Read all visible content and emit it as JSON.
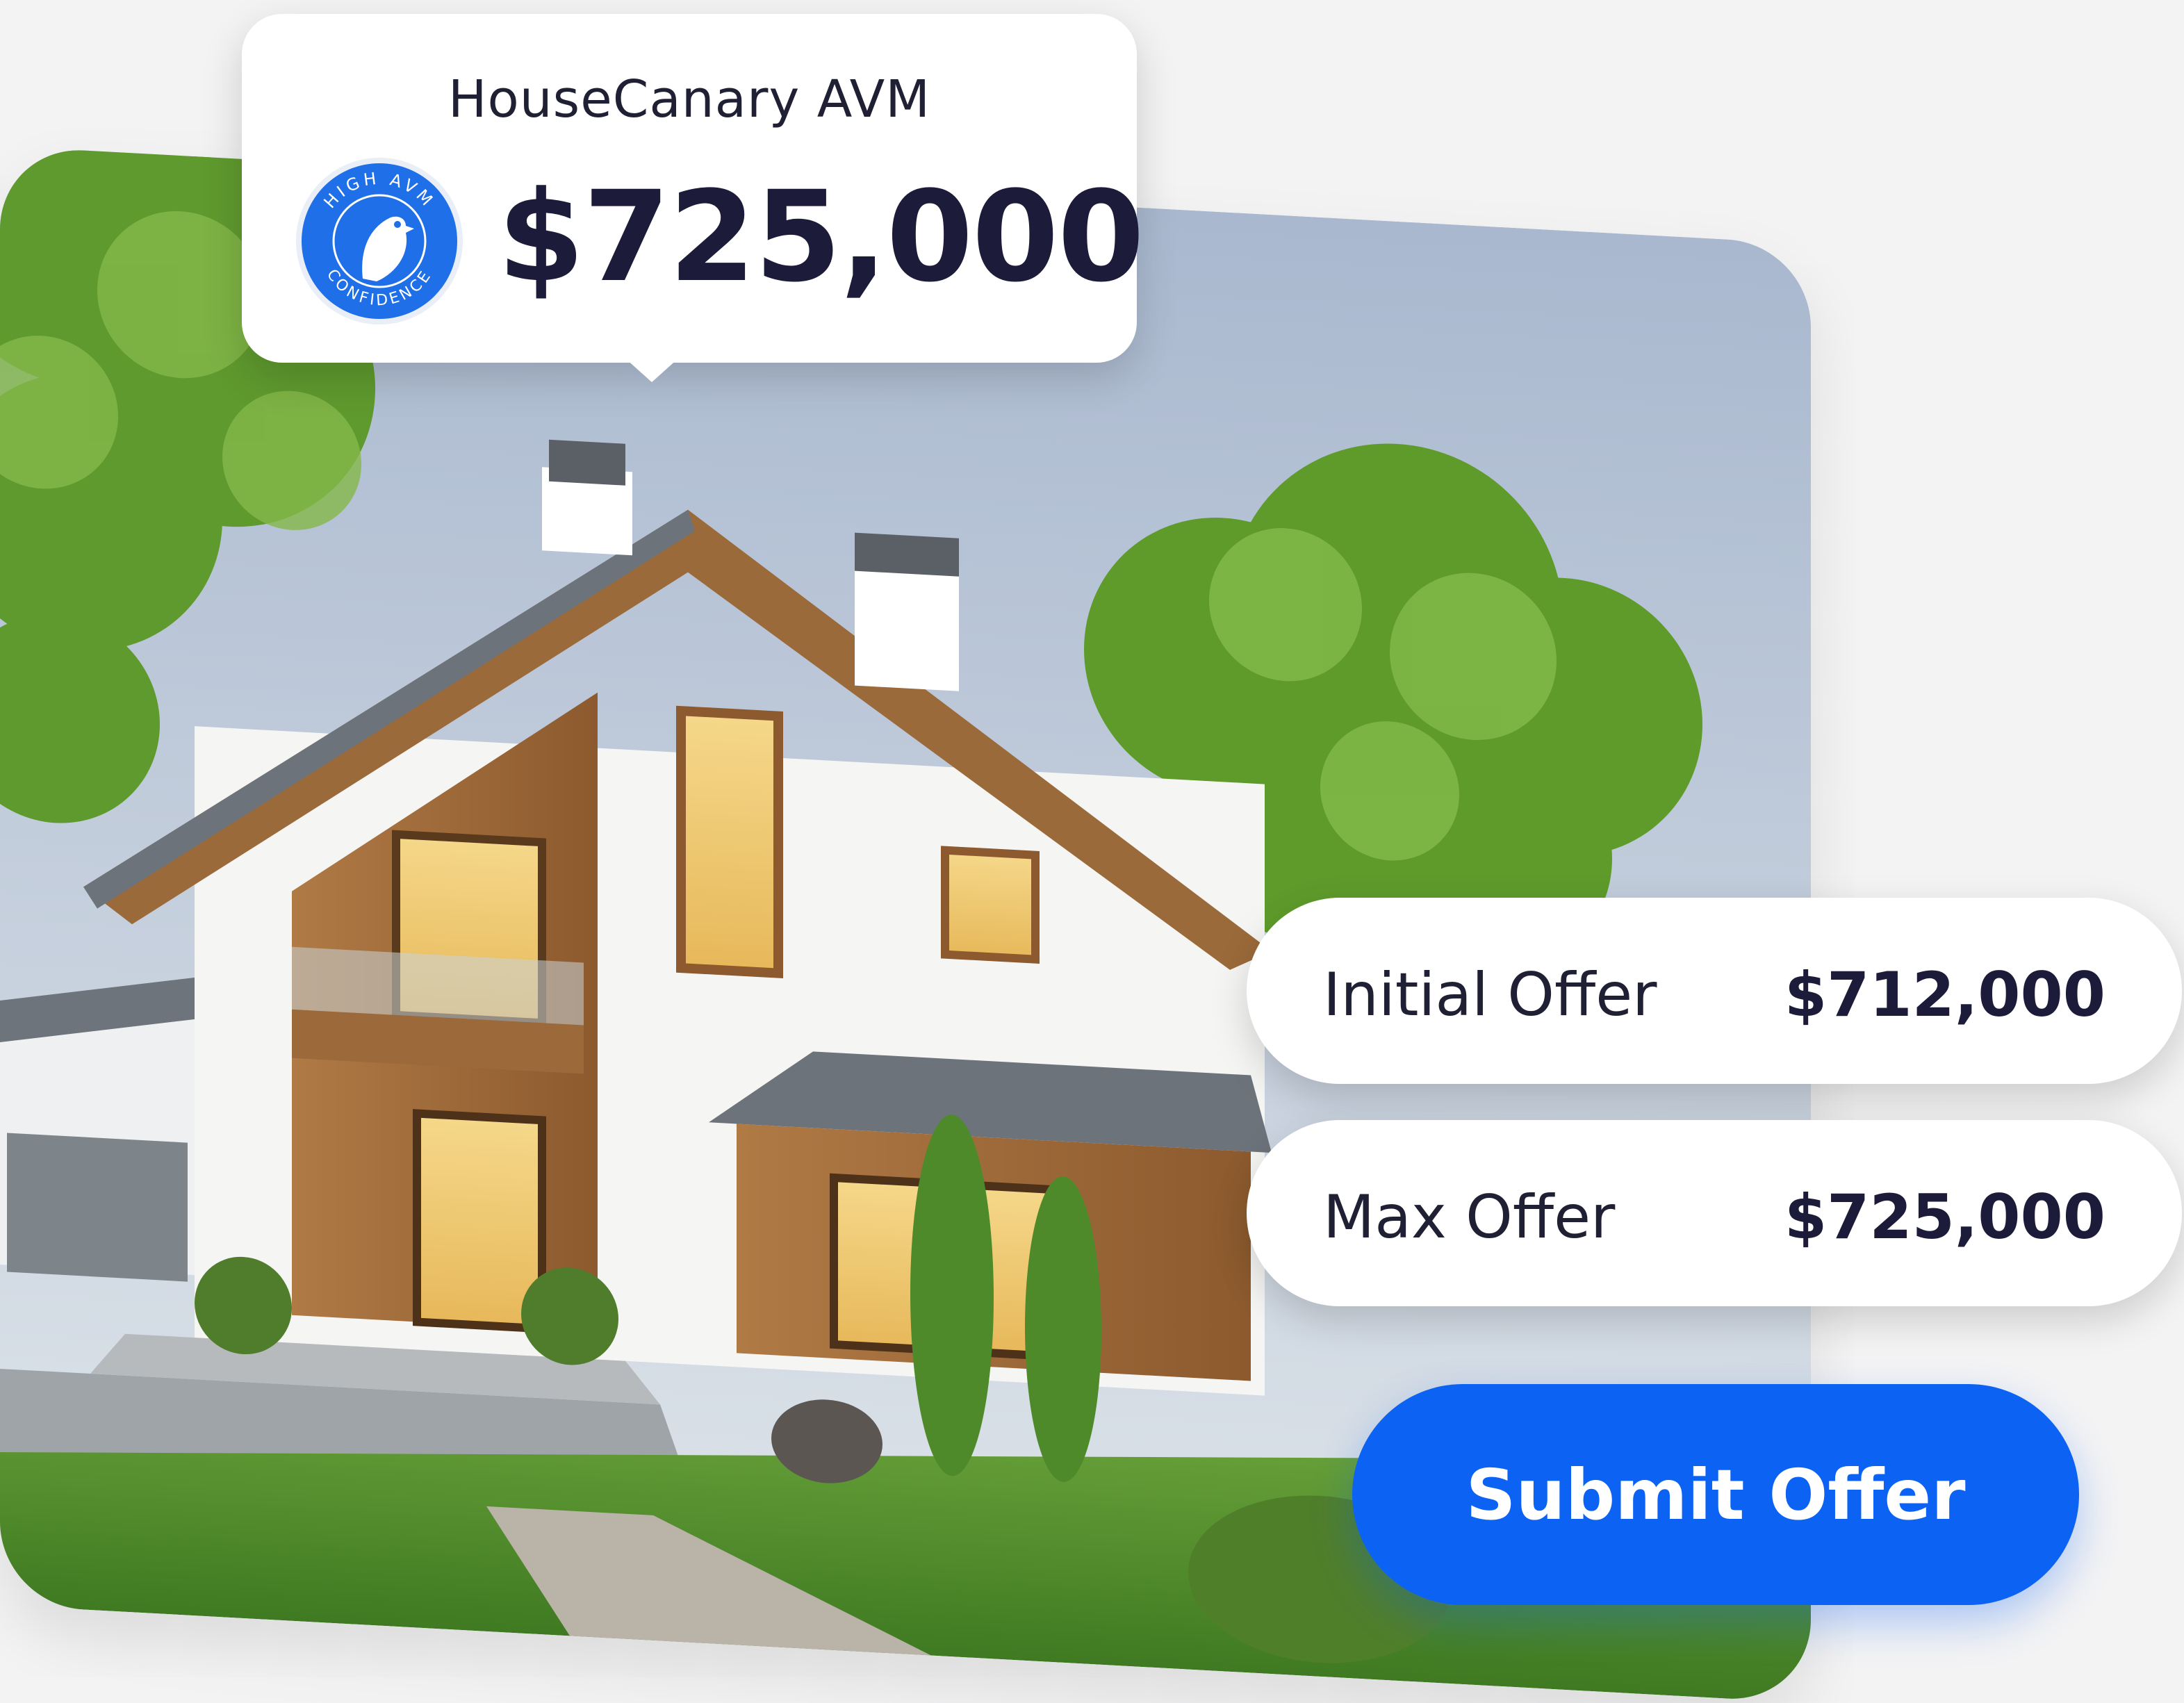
{
  "avm": {
    "title": "HouseCanary AVM",
    "value": "$725,000",
    "badge": {
      "top_text": "HIGH AVM",
      "bottom_text": "CONFIDENCE",
      "icon": "canary-bird-icon",
      "color": "#1f6fe8"
    }
  },
  "offers": {
    "initial": {
      "label": "Initial Offer",
      "value": "$712,000"
    },
    "max": {
      "label": "Max Offer",
      "value": "$725,000"
    }
  },
  "actions": {
    "submit_label": "Submit Offer"
  },
  "colors": {
    "accent": "#0c63f3",
    "text_dark": "#1c1b3a",
    "background": "#f3f3f4"
  }
}
